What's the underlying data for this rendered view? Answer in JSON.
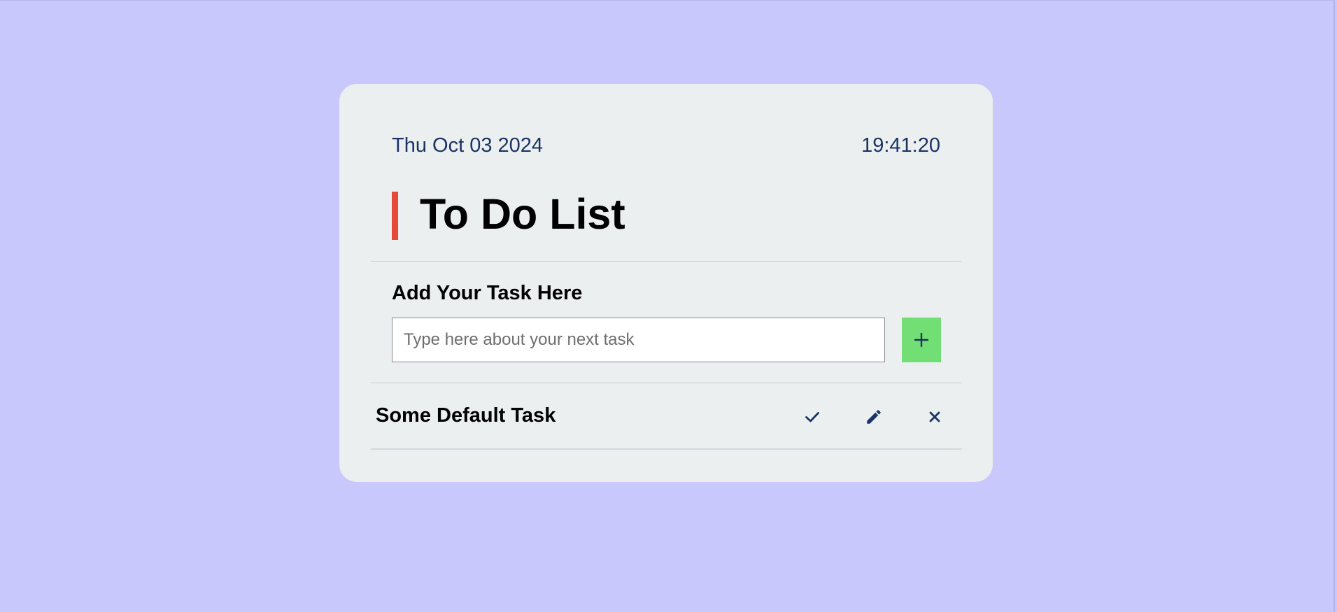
{
  "header": {
    "date": "Thu Oct 03 2024",
    "time": "19:41:20",
    "title": "To Do List"
  },
  "add_task": {
    "label": "Add Your Task Here",
    "input_placeholder": "Type here about your next task",
    "input_value": "",
    "add_button_icon": "plus-icon"
  },
  "tasks": [
    {
      "text": "Some Default Task",
      "actions": [
        "check-icon",
        "pencil-icon",
        "close-icon"
      ]
    }
  ],
  "colors": {
    "page_background": "#c8c8fc",
    "card_background": "#ebeff0",
    "accent_bar": "#e6493a",
    "add_button": "#72df74",
    "text_dark_blue": "#1b3463"
  }
}
